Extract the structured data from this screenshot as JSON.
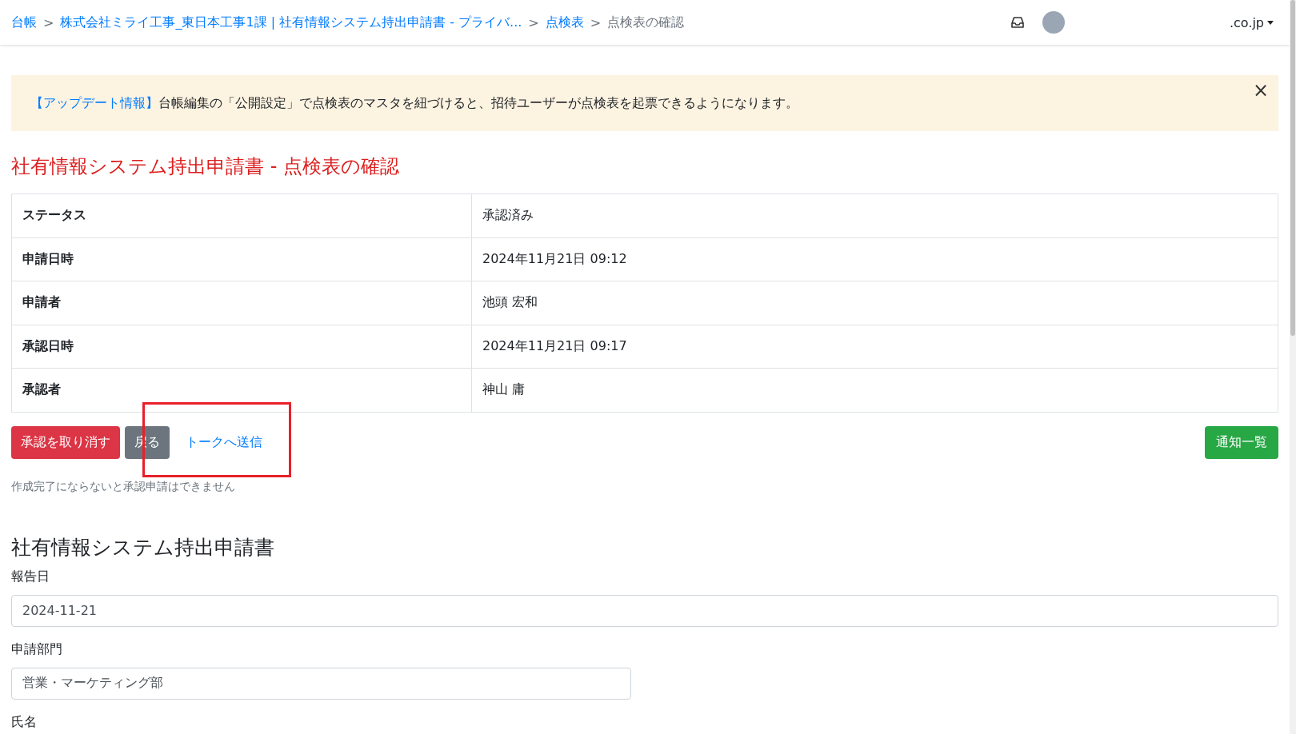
{
  "breadcrumb": [
    {
      "label": "台帳",
      "link": true
    },
    {
      "separator": ">",
      "label": "株式会社ミライ工事_東日本工事1課 | 社有情報システム持出申請書 - プライバ...",
      "link": true
    },
    {
      "separator": ">",
      "label": "点検表",
      "link": true
    },
    {
      "separator": ">",
      "label": "点検表の確認",
      "link": false
    }
  ],
  "account": {
    "label": ".co.jp"
  },
  "alert": {
    "tag": "【アップデート情報】",
    "message": "台帳編集の「公開設定」で点検表のマスタを紐づけると、招待ユーザーが点検表を起票できるようになります。",
    "close": "×"
  },
  "title": "社有情報システム持出申請書 - 点検表の確認",
  "details": [
    {
      "label": "ステータス",
      "value": "承認済み"
    },
    {
      "label": "申請日時",
      "value": "2024年11月21日 09:12"
    },
    {
      "label": "申請者",
      "value": "池頭 宏和"
    },
    {
      "label": "承認日時",
      "value": "2024年11月21日 09:17"
    },
    {
      "label": "承認者",
      "value": "神山 庸"
    }
  ],
  "actions": [
    {
      "label": "承認を取り消す",
      "kind": "danger",
      "highlighted": false
    },
    {
      "label": "戻る",
      "kind": "secondary",
      "highlighted": false
    },
    {
      "label": "トークへ送信",
      "kind": "link",
      "highlighted": true
    }
  ],
  "notify_button": "通知一覧",
  "note": "作成完了にならないと承認申請はできません",
  "form": {
    "title": "社有情報システム持出申請書",
    "fields": [
      {
        "label": "報告日",
        "value": "2024-11-21",
        "wide": true
      },
      {
        "label": "申請部門",
        "value": "営業・マーケティング部",
        "wide": false
      },
      {
        "label": "氏名"
      }
    ]
  }
}
